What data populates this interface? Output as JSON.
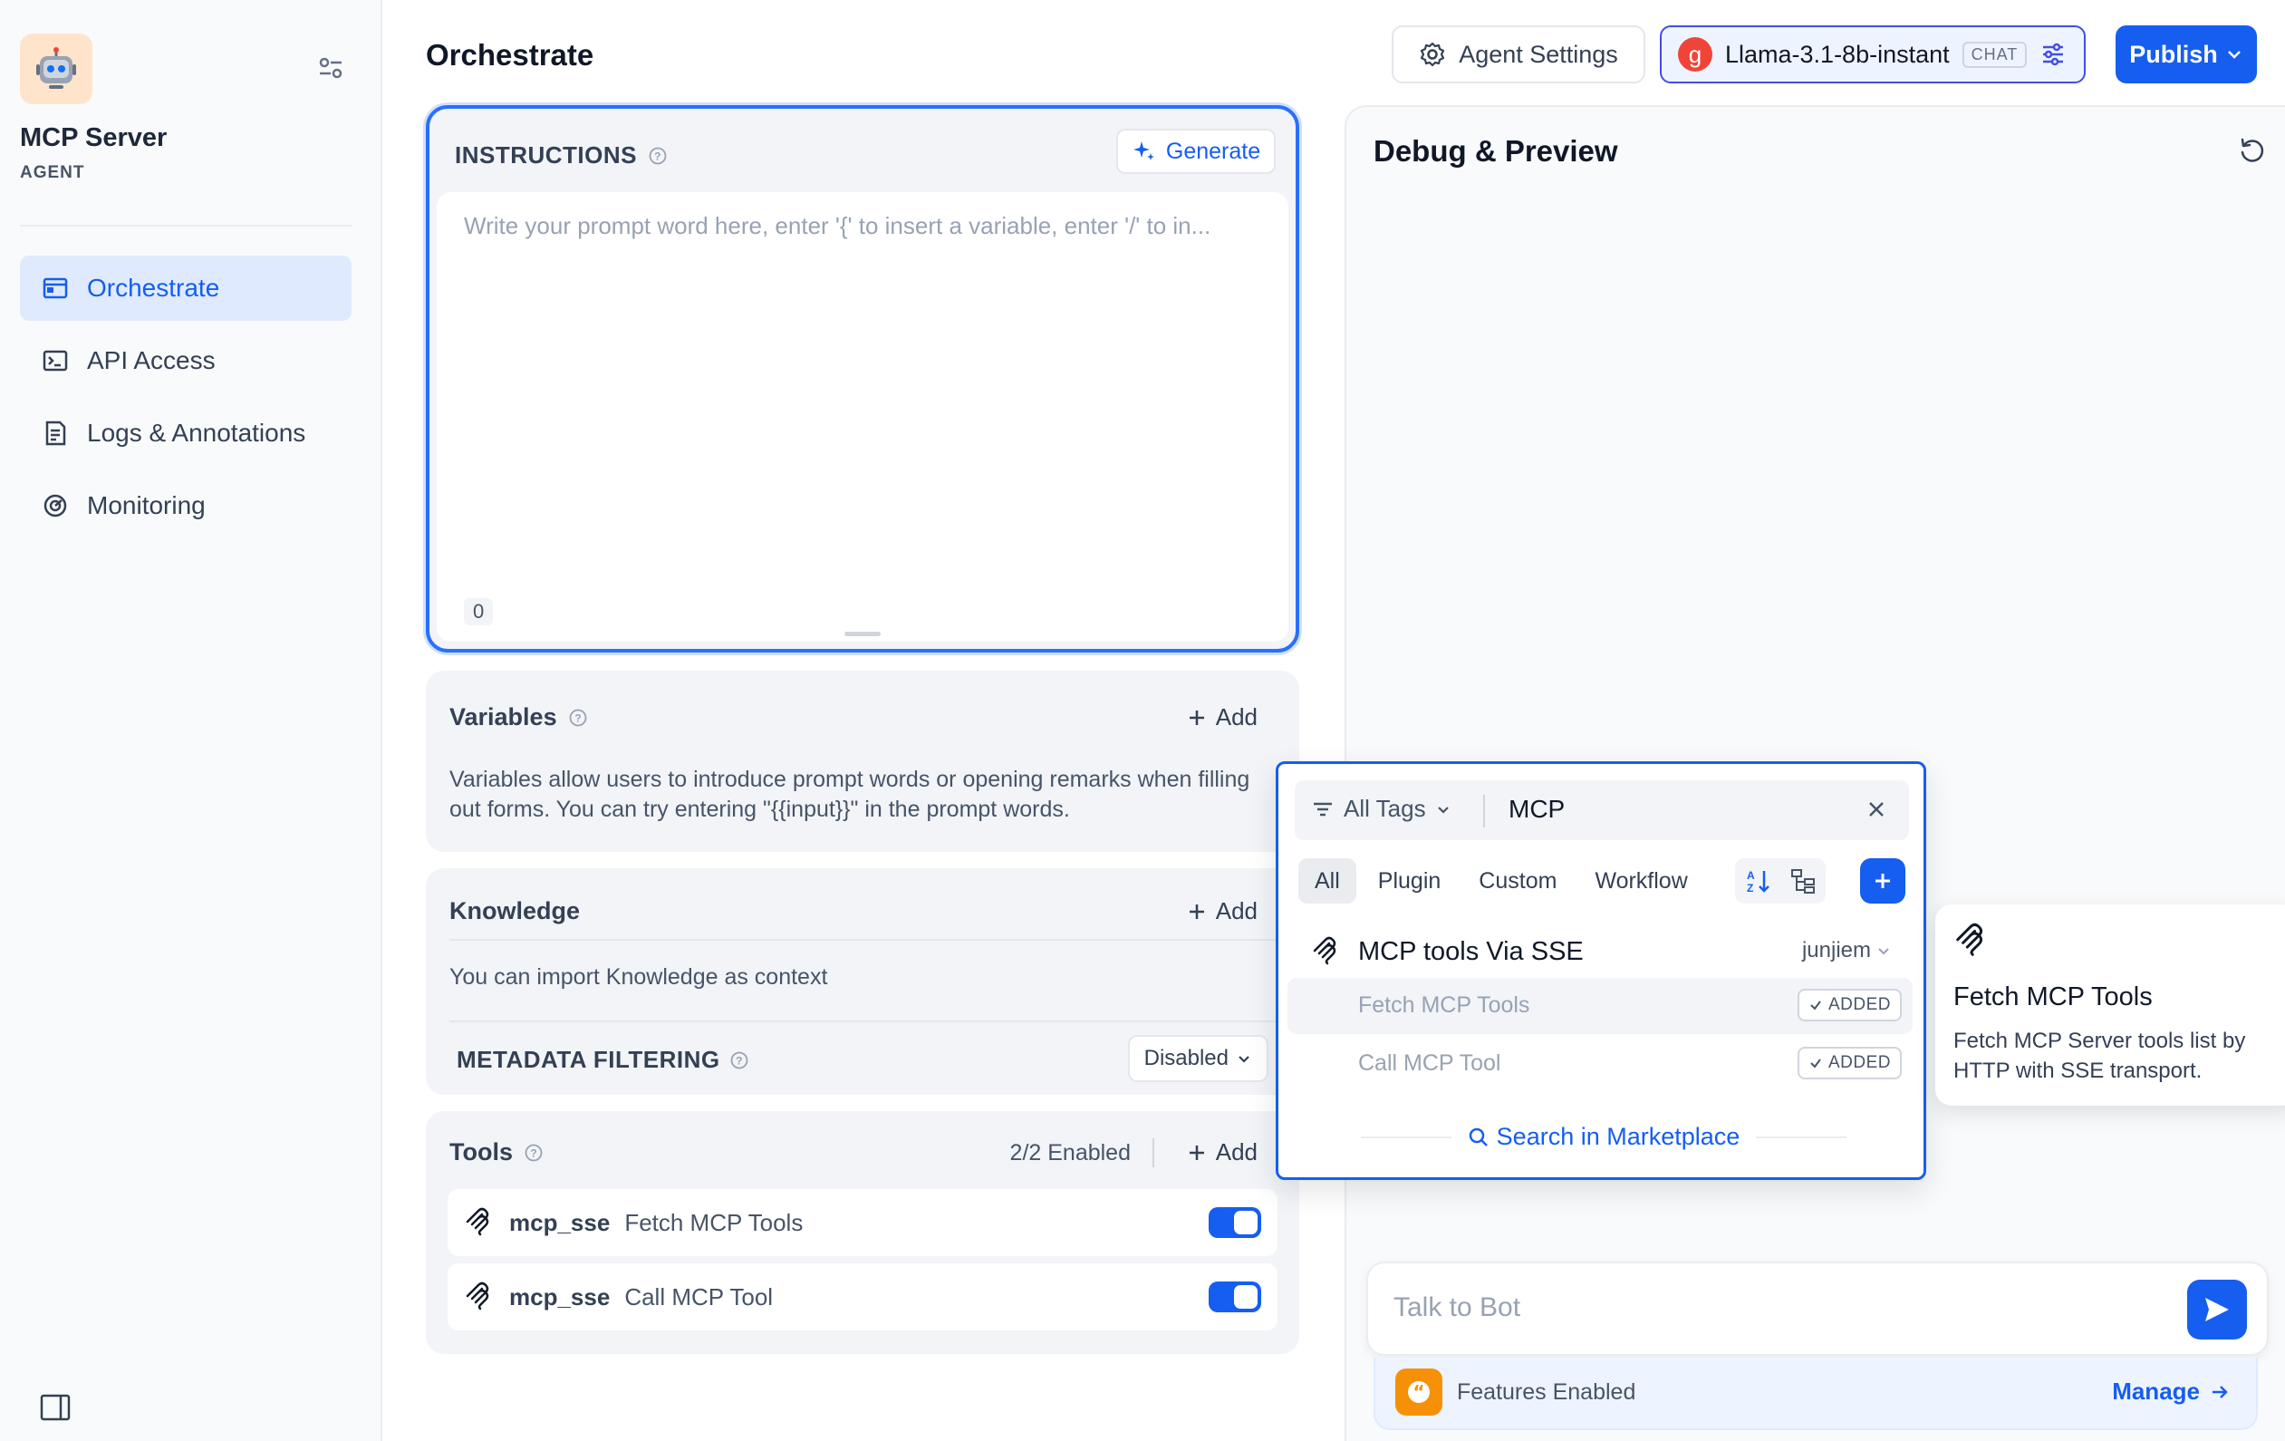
{
  "app": {
    "name": "MCP Server",
    "type": "AGENT"
  },
  "nav": {
    "items": [
      {
        "label": "Orchestrate",
        "active": true,
        "icon": "window-icon"
      },
      {
        "label": "API Access",
        "active": false,
        "icon": "terminal-icon"
      },
      {
        "label": "Logs & Annotations",
        "active": false,
        "icon": "file-list-icon"
      },
      {
        "label": "Monitoring",
        "active": false,
        "icon": "gauge-icon"
      }
    ]
  },
  "header": {
    "title": "Orchestrate",
    "agent_settings": "Agent Settings",
    "model_logo": "g",
    "model_name": "Llama-3.1-8b-instant",
    "model_mode": "CHAT",
    "publish": "Publish"
  },
  "instructions": {
    "title": "INSTRUCTIONS",
    "generate": "Generate",
    "placeholder": "Write your prompt word here, enter '{' to insert a variable, enter '/' to in...",
    "count": "0"
  },
  "variables": {
    "title": "Variables",
    "add": "Add",
    "desc_line1": "Variables allow users to introduce prompt words or opening remarks when filling",
    "desc_line2": "out forms. You can try entering \"{{input}}\" in the prompt words."
  },
  "knowledge": {
    "title": "Knowledge",
    "add": "Add",
    "desc": "You can import Knowledge as context",
    "metadata_label": "METADATA FILTERING",
    "metadata_value": "Disabled"
  },
  "tools": {
    "title": "Tools",
    "enabled": "2/2 Enabled",
    "add": "Add",
    "items": [
      {
        "provider": "mcp_sse",
        "name": "Fetch MCP Tools",
        "enabled": true
      },
      {
        "provider": "mcp_sse",
        "name": "Call MCP Tool",
        "enabled": true
      }
    ]
  },
  "debug": {
    "title": "Debug & Preview",
    "chat_placeholder": "Talk to Bot",
    "features": "Features Enabled",
    "manage": "Manage"
  },
  "picker": {
    "tags": "All Tags",
    "search_value": "MCP",
    "tabs": [
      "All",
      "Plugin",
      "Custom",
      "Workflow"
    ],
    "active_tab": "All",
    "provider": "MCP tools Via SSE",
    "author": "junjiem",
    "tools": [
      {
        "name": "Fetch MCP Tools",
        "status": "ADDED"
      },
      {
        "name": "Call MCP Tool",
        "status": "ADDED"
      }
    ],
    "marketplace": "Search in Marketplace"
  },
  "tooltip": {
    "title": "Fetch MCP Tools",
    "desc": "Fetch MCP Server tools list by HTTP with SSE transport."
  },
  "colors": {
    "accent": "#155eef",
    "active_nav_bg": "#e0eaff",
    "model_logo": "#f04438",
    "features_icon": "#f79009"
  }
}
